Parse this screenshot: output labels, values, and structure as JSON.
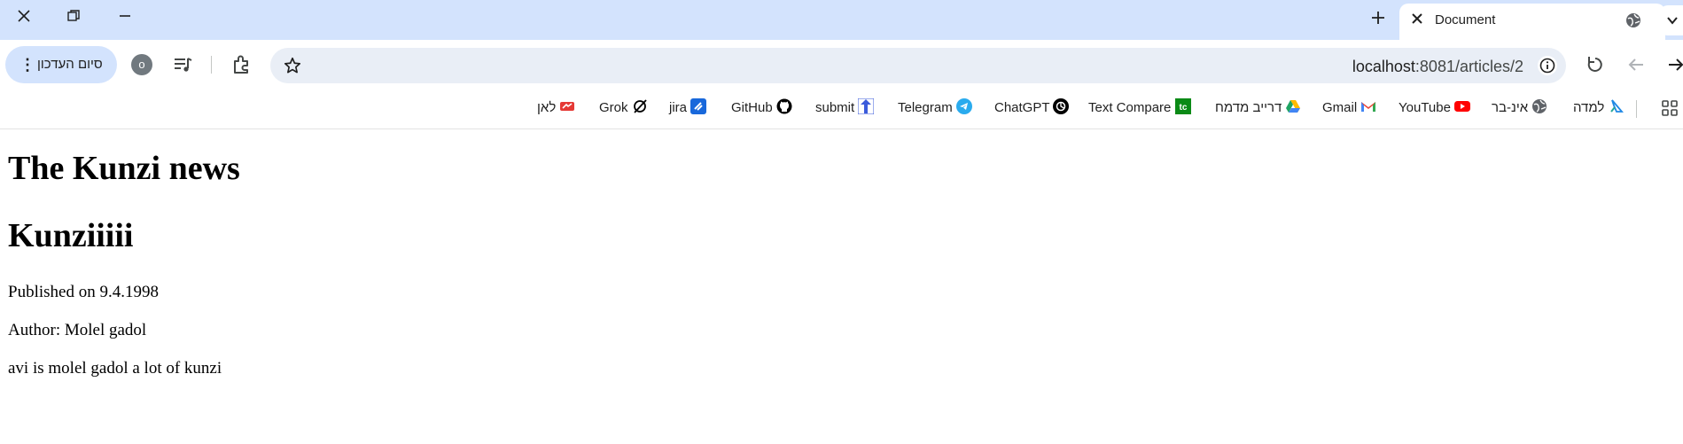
{
  "browser": {
    "tab": {
      "title": "Document"
    },
    "update_button": {
      "label": "סיום העדכון"
    },
    "profile": {
      "initial": "o"
    },
    "address": {
      "host": "localhost",
      "path": ":8081/articles/2"
    }
  },
  "bookmarks": [
    {
      "label": "לאן",
      "icon": "lan-icon",
      "color": "#e53935"
    },
    {
      "label": "Grok",
      "icon": "grok-icon",
      "color": "#000000"
    },
    {
      "label": "jira",
      "icon": "jira-icon",
      "color": "#1868db"
    },
    {
      "label": "GitHub",
      "icon": "github-icon",
      "color": "#000000"
    },
    {
      "label": "submit",
      "icon": "submit-icon",
      "color": "#3b5bdb"
    },
    {
      "label": "Telegram",
      "icon": "telegram-icon",
      "color": "#2aabee"
    },
    {
      "label": "ChatGPT",
      "icon": "chatgpt-icon",
      "color": "#000000"
    },
    {
      "label": "Text Compare",
      "icon": "text-compare-icon",
      "color": "#0b8a16"
    },
    {
      "label": "דרייב מדמח",
      "icon": "drive-icon",
      "color": "#1fa463"
    },
    {
      "label": "Gmail",
      "icon": "gmail-icon",
      "color": "#ea4335"
    },
    {
      "label": "YouTube",
      "icon": "youtube-icon",
      "color": "#ff0000"
    },
    {
      "label": "אינ-בר",
      "icon": "globe-icon",
      "color": "#5f6368"
    },
    {
      "label": "למדה",
      "icon": "lamda-icon",
      "color": "#1e88e5"
    }
  ],
  "page": {
    "heading1": "The Kunzi news",
    "heading2": "Kunziiiii",
    "published": "Published on 9.4.1998",
    "author": "Author: Molel gadol",
    "body": "avi is molel gadol a lot of kunzi"
  }
}
